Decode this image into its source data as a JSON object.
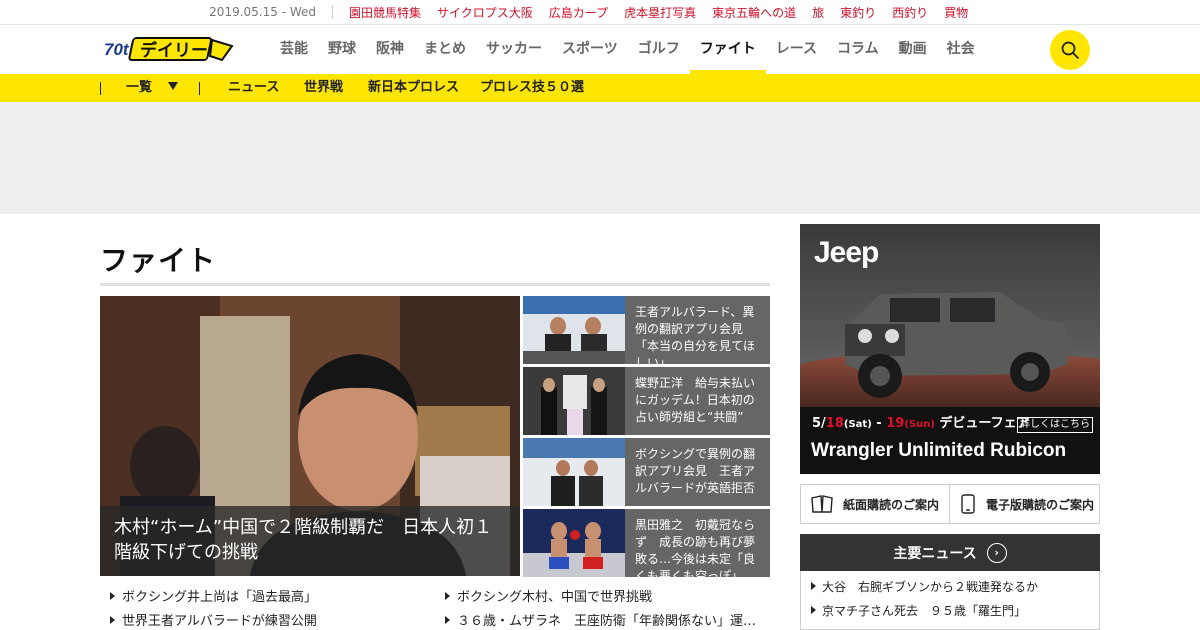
{
  "topbar": {
    "date": "2019.05.15 - Wed",
    "links": [
      "園田競馬特集",
      "サイクロプス大阪",
      "広島カープ",
      "虎本塁打写真",
      "東京五輪への道",
      "旅",
      "東釣り",
      "西釣り",
      "買物"
    ]
  },
  "header": {
    "logo_text": "デイリー",
    "logo_badge": "70th",
    "nav": [
      "芸能",
      "野球",
      "阪神",
      "まとめ",
      "サッカー",
      "スポーツ",
      "ゴルフ",
      "ファイト",
      "レース",
      "コラム",
      "動画",
      "社会"
    ],
    "active_nav": "ファイト",
    "search_icon": "search-icon"
  },
  "subnav": {
    "items": [
      "一覧",
      "ニュース",
      "世界戦",
      "新日本プロレス",
      "プロレス技５０選"
    ]
  },
  "main": {
    "title": "ファイト",
    "hero_caption": "木村“ホーム”中国で２階級制覇だ　日本人初１階級下げての挑戦",
    "side_items": [
      "王者アルバラード、異例の翻訳アプリ会見「本当の自分を見てほしい」",
      "蝶野正洋　給与未払いにガッデム！日本初の占い師労組と“共闘”",
      "ボクシングで異例の翻訳アプリ会見　王者アルバラードが英語拒否",
      "黒田雅之　初戴冠ならず　成長の跡も再び夢敗る…今後は未定「良くも悪くも空っぽ」"
    ],
    "list_left": [
      "ボクシング井上尚は「過去最高」",
      "世界王者アルバラードが練習公開"
    ],
    "list_right": [
      "ボクシング木村、中国で世界挑戦",
      "３６歳・ムザラネ　王座防衛「年齢関係ない」運…"
    ]
  },
  "sidebar": {
    "ad": {
      "brand": "Jeep",
      "date_text_1": "5/",
      "date_red_1": "18",
      "date_sat": "(Sat)",
      "date_dash": " - ",
      "date_red_2": "19",
      "date_sun": "(Sun)",
      "event": " デビューフェア",
      "button": "詳しくはこちら",
      "model": "Wrangler Unlimited Rubicon"
    },
    "subscribe_paper": "紙面購読のご案内",
    "subscribe_digital": "電子版購読のご案内",
    "major_news_title": "主要ニュース",
    "major_news": [
      "大谷　右腕ギブソンから２戦連発なるか",
      "京マチ子さん死去　９５歳「羅生門」"
    ]
  },
  "colors": {
    "accent_yellow": "#ffe600",
    "link_red": "#d0102a"
  }
}
